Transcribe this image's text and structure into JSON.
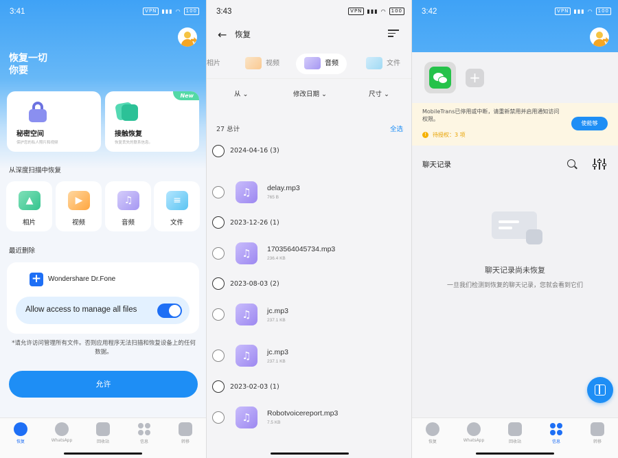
{
  "screen1": {
    "time": "3:41",
    "status_icons": "VPN",
    "battery": "100",
    "hero_line1": "恢复一切",
    "hero_line2": "你要",
    "feature1": {
      "label": "秘密空间",
      "sub": "保护您的私人照片和视频"
    },
    "feature2": {
      "label": "接触恢复",
      "sub": "恢复丢失的联系信息。",
      "tag": "New"
    },
    "deep_scan_label": "从深度扫描中恢复",
    "tiles": [
      "相片",
      "视频",
      "音频",
      "文件"
    ],
    "recent_label": "最近删除",
    "app_name": "Wondershare Dr.Fone",
    "allow_text": "Allow access to manage all files",
    "toggle_on": true,
    "note": "*请允许访问管理所有文件。否则应用程序无法扫描和恢复设备上的任何数据。",
    "allow_button": "允许"
  },
  "tabbar": [
    "恢复",
    "WhatsApp",
    "回收站",
    "信息",
    "转移"
  ],
  "screen2": {
    "time": "3:43",
    "battery": "100",
    "title": "恢复",
    "tabs": [
      "相片",
      "视频",
      "音频",
      "文件"
    ],
    "active_tab": "音频",
    "sort": [
      "从",
      "修改日期",
      "尺寸"
    ],
    "total": "27 总计",
    "select_all": "全选",
    "groups": [
      {
        "date": "2024-04-16 (3)",
        "files": [
          {
            "name": "delay.mp3",
            "size": "765 B"
          }
        ]
      },
      {
        "date": "2023-12-26 (1)",
        "files": [
          {
            "name": "1703564045734.mp3",
            "size": "236.4 KB"
          }
        ]
      },
      {
        "date": "2023-08-03 (2)",
        "files": [
          {
            "name": "jc.mp3",
            "size": "237.1 KB"
          },
          {
            "name": "jc.mp3",
            "size": "237.1 KB"
          }
        ]
      },
      {
        "date": "2023-02-03 (1)",
        "files": [
          {
            "name": "Robotvoicereport.mp3",
            "size": "7.5 KB"
          }
        ]
      }
    ]
  },
  "screen3": {
    "time": "3:42",
    "battery": "100",
    "warning": "MobileTrans已停用或中断，请重新禁用并启用通知访问权限。",
    "pending": "待授权：3 项",
    "enable_button": "使能够",
    "chat_title": "聊天记录",
    "empty_title": "聊天记录尚未恢复",
    "empty_sub": "一旦我们检测到恢复的聊天记录，您就会看到它们"
  },
  "colors": {
    "accent": "#1e8ef5",
    "brand_blue": "#1e6ff5",
    "warning_bg": "#fdf6e3"
  }
}
